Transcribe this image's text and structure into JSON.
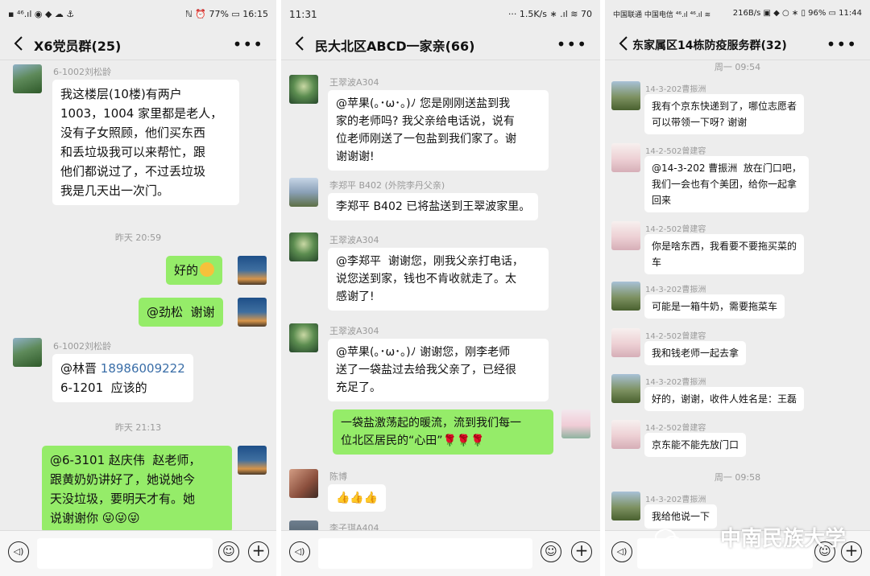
{
  "panel1": {
    "status": {
      "left": "▪ ⁴⁶.ıl ◉ ◆ ☁ ⚓",
      "right": "ℕ ⏰ 77% ▭ 16:15"
    },
    "title": "X6党员群(25)",
    "messages": {
      "m1": {
        "sender": "6-1002刘松龄",
        "text": "我这楼层(10楼)有两户\n1003，1004 家里都是老人，\n没有子女照顾，他们买东西\n和丢垃圾我可以来帮忙，跟\n他们都说过了，不过丢垃圾\n我是几天出一次门。"
      },
      "t1": "昨天 20:59",
      "m2": {
        "text": "好的"
      },
      "m3": {
        "text": "@劲松  谢谢"
      },
      "m4": {
        "sender": "6-1002刘松龄",
        "text_prefix": "@林晋 ",
        "phone": "18986009222",
        "text_line2": "6-1201  应该的"
      },
      "t2": "昨天 21:13",
      "m5": {
        "text": "@6-3101 赵庆伟  赵老师，\n跟黄奶奶讲好了，她说她今\n天没垃圾，要明天才有。她\n说谢谢你 😜😜😜"
      }
    }
  },
  "panel2": {
    "status": {
      "left": "11:31",
      "right": "··· 1.5K/s ∗ .ıl ≋ 70"
    },
    "title": "民大北区ABCD一家亲(66)",
    "messages": {
      "m1": {
        "sender": "王翠波A304",
        "text": "@苹果(｡･ω･｡)ﾉ 您是刚刚送盐到我\n家的老师吗? 我父亲给电话说，说有\n位老师刚送了一包盐到我们家了。谢\n谢谢谢!"
      },
      "m2": {
        "sender": "李郑平 B402 (外院李丹父亲)",
        "text": "李郑平 B402 已将盐送到王翠波家里。"
      },
      "m3": {
        "sender": "王翠波A304",
        "text": "@李郑平  谢谢您，刚我父亲打电话，\n说您送到家，钱也不肯收就走了。太\n感谢了!"
      },
      "m4": {
        "sender": "王翠波A304",
        "text": "@苹果(｡･ω･｡)ﾉ 谢谢您，刚李老师\n送了一袋盐过去给我父亲了，已经很\n充足了。"
      },
      "m5": {
        "text": "一袋盐激荡起的暖流，流到我们每一\n位北区居民的“心田”🌹🌹🌹"
      },
      "m6": {
        "sender": "陈博",
        "text": "👍👍👍"
      },
      "m7": {
        "sender": "李子琪A404"
      }
    }
  },
  "panel3": {
    "status": {
      "left": "中国联通 中国电信 ⁴⁶.ıl ⁴⁶.ıl ≋",
      "right": "216B/s ▣ ◆ ○ ∗ ▯ 96% ▭ 11:44"
    },
    "title": "东家属区14栋防疫服务群(32)",
    "messages": {
      "t1": "周一 09:54",
      "m1": {
        "sender": "14-3-202曹振洲",
        "text": "我有个京东快递到了，哪位志愿者\n可以带领一下呀? 谢谢"
      },
      "m2": {
        "sender": "14-2-502曾建容",
        "text": "@14-3-202 曹振洲  放在门口吧，\n我们一会也有个美团，给你一起拿\n回来"
      },
      "m3": {
        "sender": "14-2-502曾建容",
        "text": "你是啥东西，我看要不要拖买菜的\n车"
      },
      "m4": {
        "sender": "14-3-202曹振洲",
        "text": "可能是一箱牛奶，需要拖菜车"
      },
      "m5": {
        "sender": "14-2-502曾建容",
        "text": "我和钱老师一起去拿"
      },
      "m6": {
        "sender": "14-3-202曹振洲",
        "text": "好的，谢谢，收件人姓名是：王磊"
      },
      "m7": {
        "sender": "14-2-502曾建容",
        "text": "京东能不能先放门口"
      },
      "t2": "周一 09:58",
      "m8": {
        "sender": "14-3-202曹振洲",
        "text": "我给他说一下"
      }
    }
  },
  "watermark": "中南民族大学",
  "colors": {
    "outgoing_bubble": "#95ec69",
    "incoming_bubble": "#ffffff",
    "background": "#ededed"
  }
}
